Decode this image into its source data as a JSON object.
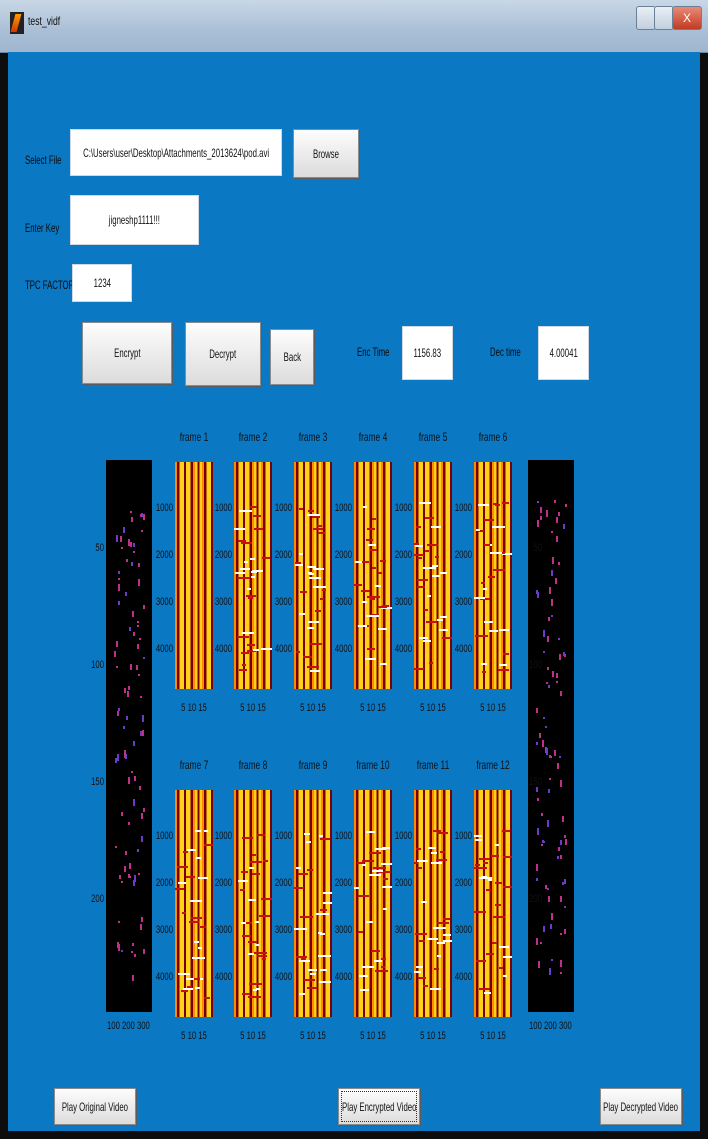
{
  "window": {
    "title": "test_vidf",
    "close_glyph": "X"
  },
  "form": {
    "file_label": "Select File",
    "file_value": "C:\\Users\\user\\Desktop\\Attachments_2013624\\pod.avi",
    "browse_label": "Browse",
    "key_label": "Enter Key",
    "key_value": "jigneshp1111!!!",
    "tpc_label": "TPC FACTOR",
    "tpc_value": "1234",
    "encrypt_label": "Encrypt",
    "decrypt_label": "Decrypt",
    "back_label": "Back",
    "enc_time_label": "Enc Time",
    "enc_time_value": "1156.83",
    "dec_time_label": "Dec time",
    "dec_time_value": "4.00041"
  },
  "frames": {
    "titles": [
      "frame 1",
      "frame 2",
      "frame 3",
      "frame 4",
      "frame 5",
      "frame 6",
      "frame 7",
      "frame 8",
      "frame 9",
      "frame 10",
      "frame 11",
      "frame 12"
    ],
    "y_ticks": [
      "1000",
      "2000",
      "3000",
      "4000"
    ],
    "x_ticks": "5  10 15"
  },
  "image_axes": {
    "y_ticks": [
      "50",
      "100",
      "150",
      "200"
    ],
    "x_ticks": "100 200 300"
  },
  "bottom": {
    "play_original": "Play Original Video",
    "play_encrypted": "Play Encrypted Video",
    "play_decrypted": "Play Decrypted Video"
  },
  "colors": {
    "background": "#0b78c4",
    "stripe_yellow": "#ffd21a",
    "stripe_dark": "#7a0000",
    "image_magenta": "#c0308a"
  }
}
